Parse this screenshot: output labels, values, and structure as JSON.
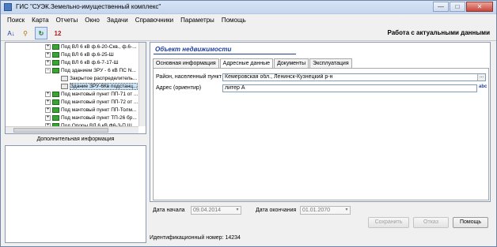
{
  "window": {
    "title": "ГИС \"СУЭК.Земельно-имущественный комплекс\"",
    "minimize": "—",
    "maximize": "□",
    "close": "✕"
  },
  "menu": [
    "Поиск",
    "Карта",
    "Отчеты",
    "Окно",
    "Задачи",
    "Справочники",
    "Параметры",
    "Помощь"
  ],
  "toolbar": {
    "buttons": [
      "sort-az-icon",
      "filter-icon",
      "refresh-icon",
      "calendar-icon"
    ],
    "sort_glyph": "A↓",
    "filter_glyph": "⚲",
    "refresh_glyph": "↻",
    "calendar_glyph": "12",
    "status": "Работа с актуальными данными"
  },
  "tree": {
    "items": [
      {
        "label": "Под ВЛ 6 кВ ф.6-20-Скв., ф.6-...",
        "icon": "green",
        "exp": "+"
      },
      {
        "label": "Под ВЛ 6 кВ ф.6-25-Ш",
        "icon": "green",
        "exp": "+"
      },
      {
        "label": "Под ВЛ 6 кВ ф.6-7-17-Ш",
        "icon": "green",
        "exp": "+"
      },
      {
        "label": "Под зданием ЗРУ - 6 кВ ПС N...",
        "icon": "green",
        "exp": "−"
      },
      {
        "label": "Закрытое распределитель...",
        "icon": "doc",
        "exp": ""
      },
      {
        "label": "Здание ЗРУ-6Кв подстанц...",
        "icon": "doc",
        "exp": "",
        "selected": true
      },
      {
        "label": "Под мачтовый пункт ПП-71 от ...",
        "icon": "green",
        "exp": "+"
      },
      {
        "label": "Под мачтовый пункт ПП-72 от ...",
        "icon": "green",
        "exp": "+"
      },
      {
        "label": "Под мачтовый пункт ПП-Толм...",
        "icon": "green",
        "exp": "+"
      },
      {
        "label": "Под мачтовый пункт ТП-26 бр...",
        "icon": "green",
        "exp": "+"
      },
      {
        "label": "Под Опоры ВЛ 6 кВ Ф6-3-П,Ш ...",
        "icon": "green",
        "exp": "+"
      }
    ]
  },
  "left": {
    "additional_info_label": "Дополнительная информация"
  },
  "object": {
    "title": "Объект недвижимости",
    "tabs": [
      "Основная информация",
      "Адресные данные",
      "Документы",
      "Эксплуатация"
    ],
    "active_tab": 1,
    "fields": {
      "district_label": "Район, населенный пункт",
      "district_value": "Кемеровская обл., Ленинск-Кузнецкий р-н",
      "address_label": "Адрес (ориентир)",
      "address_value": "литер А",
      "ellipsis": "...",
      "abc": "abc"
    }
  },
  "bottom": {
    "date_start_label": "Дата начала",
    "date_start_value": "09.04.2014",
    "date_end_label": "Дата окончания",
    "date_end_value": "01.01.2070",
    "dropdown_glyph": "▾",
    "save_button": "Сохранить",
    "cancel_button": "Отказ",
    "help_button": "Помощь",
    "id_text": "Идентификационный номер: 14234"
  }
}
